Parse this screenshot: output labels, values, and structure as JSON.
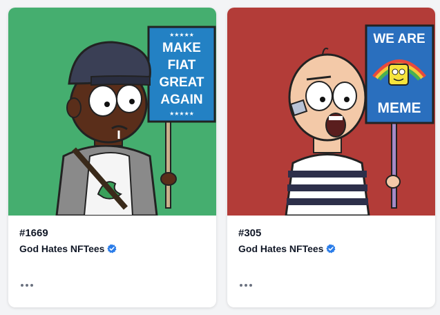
{
  "cards": [
    {
      "token_id": "#1669",
      "collection": "God Hates NFTees",
      "verified": true,
      "art": {
        "background": "#45ae6f",
        "sign_color": "#2381c4",
        "sign_lines": [
          "MAKE",
          "FIAT",
          "GREAT",
          "AGAIN"
        ],
        "icon": "green-character-art"
      },
      "menu_icon": "more-horizontal-icon"
    },
    {
      "token_id": "#305",
      "collection": "God Hates NFTees",
      "verified": true,
      "art": {
        "background": "#b33c38",
        "sign_color": "#2a6fbe",
        "sign_lines": [
          "WE ARE",
          "MEME"
        ],
        "icon": "red-character-art"
      },
      "menu_icon": "more-horizontal-icon"
    }
  ],
  "colors": {
    "verified_badge": "#2b7de9",
    "text_primary": "#111827",
    "menu_dots": "#6b7280"
  }
}
